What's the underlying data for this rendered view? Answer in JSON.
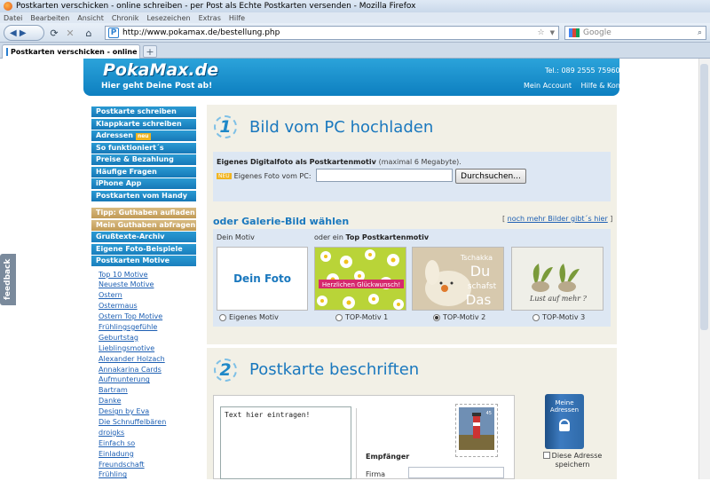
{
  "window": {
    "title": "Postkarten verschicken - online schreiben - per Post als Echte Postkarten versenden - Mozilla Firefox"
  },
  "menu": [
    "Datei",
    "Bearbeiten",
    "Ansicht",
    "Chronik",
    "Lesezeichen",
    "Extras",
    "Hilfe"
  ],
  "browser": {
    "url": "http://www.pokamax.de/bestellung.php",
    "search_placeholder": "Google",
    "tab_title": "Postkarten verschicken - online schr...",
    "new_tab": "+"
  },
  "feedback": "feedback",
  "header": {
    "logo": "PokaMax.de",
    "slogan": "Hier geht Deine Post ab!",
    "tel": "Tel.: 089 2555 75960",
    "links": [
      "Mein Account",
      "Hilfe & Kontakt"
    ]
  },
  "sidebar": {
    "main": [
      "Postkarte schreiben",
      "Klappkarte schreiben",
      "Adressen",
      "So funktioniert´s",
      "Preise & Bezahlung",
      "Häufige Fragen",
      "iPhone App",
      "Postkarten vom Handy"
    ],
    "adressen_badge": "neu",
    "tan": [
      "Tipp: Guthaben aufladen",
      "Mein Guthaben abfragen"
    ],
    "more": [
      "Grußtexte-Archiv",
      "Eigene Foto-Beispiele",
      "Postkarten Motive"
    ],
    "sublinks": [
      "Top 10 Motive",
      "Neueste Motive",
      "Ostern",
      "Ostermaus",
      "Ostern Top Motive",
      "Frühlingsgefühle",
      "Geburtstag",
      "Lieblingsmotive",
      "Alexander Holzach",
      "Annakarina Cards",
      "Aufmunterung",
      "Bartram",
      "Danke",
      "Design by Eva",
      "Die Schnuffelbären",
      "droigks",
      "Einfach so",
      "Einladung",
      "Freundschaft",
      "Frühling"
    ]
  },
  "step1": {
    "num": "1",
    "title": "Bild vom PC hochladen",
    "upload_head": "Eigenes Digitalfoto als Postkartenmotiv",
    "upload_hint": "(maximal 6 Megabyte).",
    "upload_label": "Eigenes Foto vom PC:",
    "upload_tag": "NEU",
    "browse_btn": "Durchsuchen...",
    "gallery_head": "oder Galerie-Bild wählen",
    "gallery_link": "noch mehr Bilder gibt´s hier",
    "label_own": "Dein Motiv",
    "label_or": "oder ein",
    "label_top": "Top Postkartenmotiv",
    "own_photo": "Dein Foto",
    "motif1_text": "Herzlichen Glückwunsch!",
    "motif2_text": [
      "Tschakka",
      "Du",
      "schafst",
      "Das"
    ],
    "motif3_text": "Lust auf mehr ?",
    "radios": [
      {
        "label": "Eigenes Motiv",
        "selected": false
      },
      {
        "label": "TOP-Motiv 1",
        "selected": false
      },
      {
        "label": "TOP-Motiv 2",
        "selected": true
      },
      {
        "label": "TOP-Motiv 3",
        "selected": false
      }
    ]
  },
  "step2": {
    "num": "2",
    "title": "Postkarte beschriften",
    "text_placeholder": "Text hier eintragen!",
    "recipient": "Empfänger",
    "company": "Firma",
    "address_book": "Meine Adressen",
    "save_address": "Diese Adresse speichern"
  }
}
